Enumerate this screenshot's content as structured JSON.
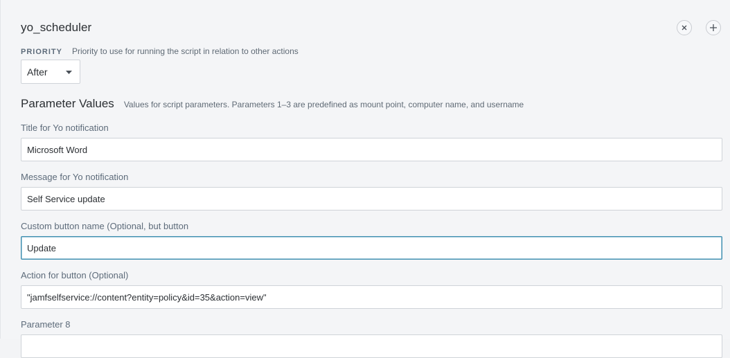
{
  "script": {
    "title": "yo_scheduler",
    "remove_icon": "close-icon",
    "add_icon": "plus-icon"
  },
  "priority": {
    "label": "PRIORITY",
    "help": "Priority to use for running the script in relation to other actions",
    "selected": "After"
  },
  "parameters": {
    "title": "Parameter Values",
    "help": "Values for script parameters. Parameters 1–3 are predefined as mount point, computer name, and username",
    "fields": [
      {
        "label": "Title for Yo notification",
        "value": "Microsoft Word"
      },
      {
        "label": "Message for Yo notification",
        "value": "Self Service update"
      },
      {
        "label": "Custom button name (Optional, but button",
        "value": "Update"
      },
      {
        "label": "Action for button (Optional)",
        "value": "\"jamfselfservice://content?entity=policy&id=35&action=view\""
      },
      {
        "label": "Parameter 8",
        "value": ""
      }
    ]
  },
  "colors": {
    "focus_border": "#3f8fb0",
    "label": "#5d6b7a",
    "background": "#f4f5f7"
  }
}
